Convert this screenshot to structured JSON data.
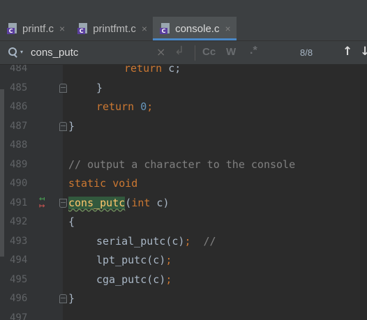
{
  "tabs": [
    {
      "label": "printf.c",
      "icon": "c-file-icon",
      "active": false
    },
    {
      "label": "printfmt.c",
      "icon": "c-file-icon",
      "active": false
    },
    {
      "label": "console.c",
      "icon": "c-file-icon",
      "active": true
    }
  ],
  "tab_close_glyph": "×",
  "search": {
    "value": "cons_putc",
    "case_label": "Cc",
    "word_label": "W",
    "regex_label": ".*",
    "match_count": "8/8"
  },
  "colors": {
    "keyword": "#cc7832",
    "number": "#6897bb",
    "comment": "#808080",
    "function_highlight": "#32593d",
    "accent": "#4a88c7"
  },
  "code_lines": [
    {
      "num": "484",
      "text": "return c;"
    },
    {
      "num": "485",
      "text": "}"
    },
    {
      "num": "486",
      "text": "return 0;"
    },
    {
      "num": "487",
      "text": "}"
    },
    {
      "num": "488",
      "text": ""
    },
    {
      "num": "489",
      "text": "// output a character to the console"
    },
    {
      "num": "490",
      "text": "static void"
    },
    {
      "num": "491",
      "text": "cons_putc(int c)"
    },
    {
      "num": "492",
      "text": "{"
    },
    {
      "num": "493",
      "text": "serial_putc(c);  //"
    },
    {
      "num": "494",
      "text": "lpt_putc(c);"
    },
    {
      "num": "495",
      "text": "cga_putc(c);"
    },
    {
      "num": "496",
      "text": "}"
    },
    {
      "num": "497",
      "text": ""
    }
  ],
  "tokens": {
    "l484_kw": "return",
    "l484_rest": " c;",
    "l486_kw": "return",
    "l486_num": "0",
    "l486_semi": ";",
    "l490_kw": "static void",
    "l491_fn": "cons_putc",
    "l491_paren": "(",
    "l491_kw": "int",
    "l491_rest": " c)",
    "l493_call": "serial_putc(c)",
    "l493_semi": ";",
    "l493_comment": "  //",
    "l494_call": "lpt_putc(c)",
    "l494_semi": ";",
    "l495_call": "cga_putc(c)",
    "l495_semi": ";"
  },
  "gutter_marker": "change-arrows-icon"
}
